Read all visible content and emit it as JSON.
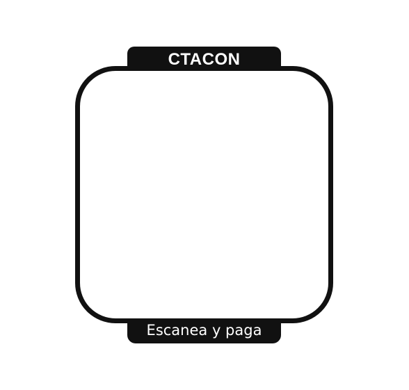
{
  "brand": {
    "name": "CTACON"
  },
  "caption": {
    "text": "Escanea y paga"
  },
  "colors": {
    "frame": "#111111",
    "background": "#ffffff",
    "text_on_dark": "#ffffff"
  }
}
